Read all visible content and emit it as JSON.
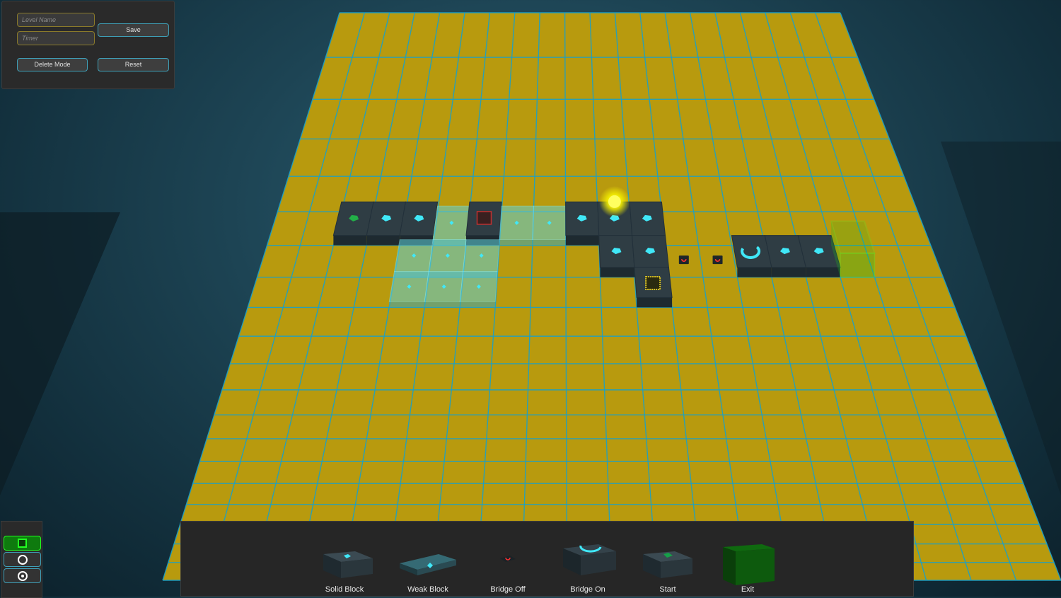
{
  "editor": {
    "level_name_placeholder": "Level Name",
    "timer_placeholder": "Timer",
    "save_label": "Save",
    "delete_mode_label": "Delete Mode",
    "reset_label": "Reset"
  },
  "tools": [
    {
      "icon": "square-select-icon",
      "active": true
    },
    {
      "icon": "ring-icon",
      "active": false
    },
    {
      "icon": "target-icon",
      "active": false
    }
  ],
  "palette": {
    "items": [
      {
        "label": "Solid Block",
        "icon": "solid-block-icon"
      },
      {
        "label": "Weak Block",
        "icon": "weak-block-icon"
      },
      {
        "label": "Bridge Off",
        "icon": "bridge-off-icon"
      },
      {
        "label": "Bridge On",
        "icon": "bridge-on-icon"
      },
      {
        "label": "Start",
        "icon": "start-block-icon"
      },
      {
        "label": "Exit",
        "icon": "exit-block-icon"
      }
    ]
  },
  "grid": {
    "columns": 20,
    "rows": 20,
    "floor_color": "#b89a0e",
    "line_color": "#1aa0c8"
  },
  "level": {
    "tiles": [
      {
        "type": "start",
        "col": 2,
        "row": 5
      },
      {
        "type": "solid",
        "col": 3,
        "row": 5
      },
      {
        "type": "solid",
        "col": 4,
        "row": 5
      },
      {
        "type": "weak",
        "col": 5,
        "row": 5
      },
      {
        "type": "trap",
        "col": 6,
        "row": 5
      },
      {
        "type": "weak",
        "col": 7,
        "row": 5
      },
      {
        "type": "weak",
        "col": 8,
        "row": 5
      },
      {
        "type": "solid",
        "col": 9,
        "row": 5
      },
      {
        "type": "solid",
        "col": 10,
        "row": 5
      },
      {
        "type": "solid",
        "col": 11,
        "row": 5
      },
      {
        "type": "weak",
        "col": 4,
        "row": 6
      },
      {
        "type": "weak",
        "col": 5,
        "row": 6
      },
      {
        "type": "weak",
        "col": 6,
        "row": 6
      },
      {
        "type": "solid",
        "col": 10,
        "row": 6
      },
      {
        "type": "solid",
        "col": 11,
        "row": 6
      },
      {
        "type": "bridge-off",
        "col": 12,
        "row": 6
      },
      {
        "type": "bridge-off",
        "col": 13,
        "row": 6
      },
      {
        "type": "bridge-on",
        "col": 14,
        "row": 6
      },
      {
        "type": "solid",
        "col": 15,
        "row": 6
      },
      {
        "type": "solid",
        "col": 16,
        "row": 6
      },
      {
        "type": "exit",
        "col": 17,
        "row": 6
      },
      {
        "type": "weak",
        "col": 4,
        "row": 7
      },
      {
        "type": "weak",
        "col": 5,
        "row": 7
      },
      {
        "type": "weak",
        "col": 6,
        "row": 7
      },
      {
        "type": "gold",
        "col": 11,
        "row": 7
      }
    ],
    "player": {
      "col": 10,
      "row": 5
    }
  }
}
